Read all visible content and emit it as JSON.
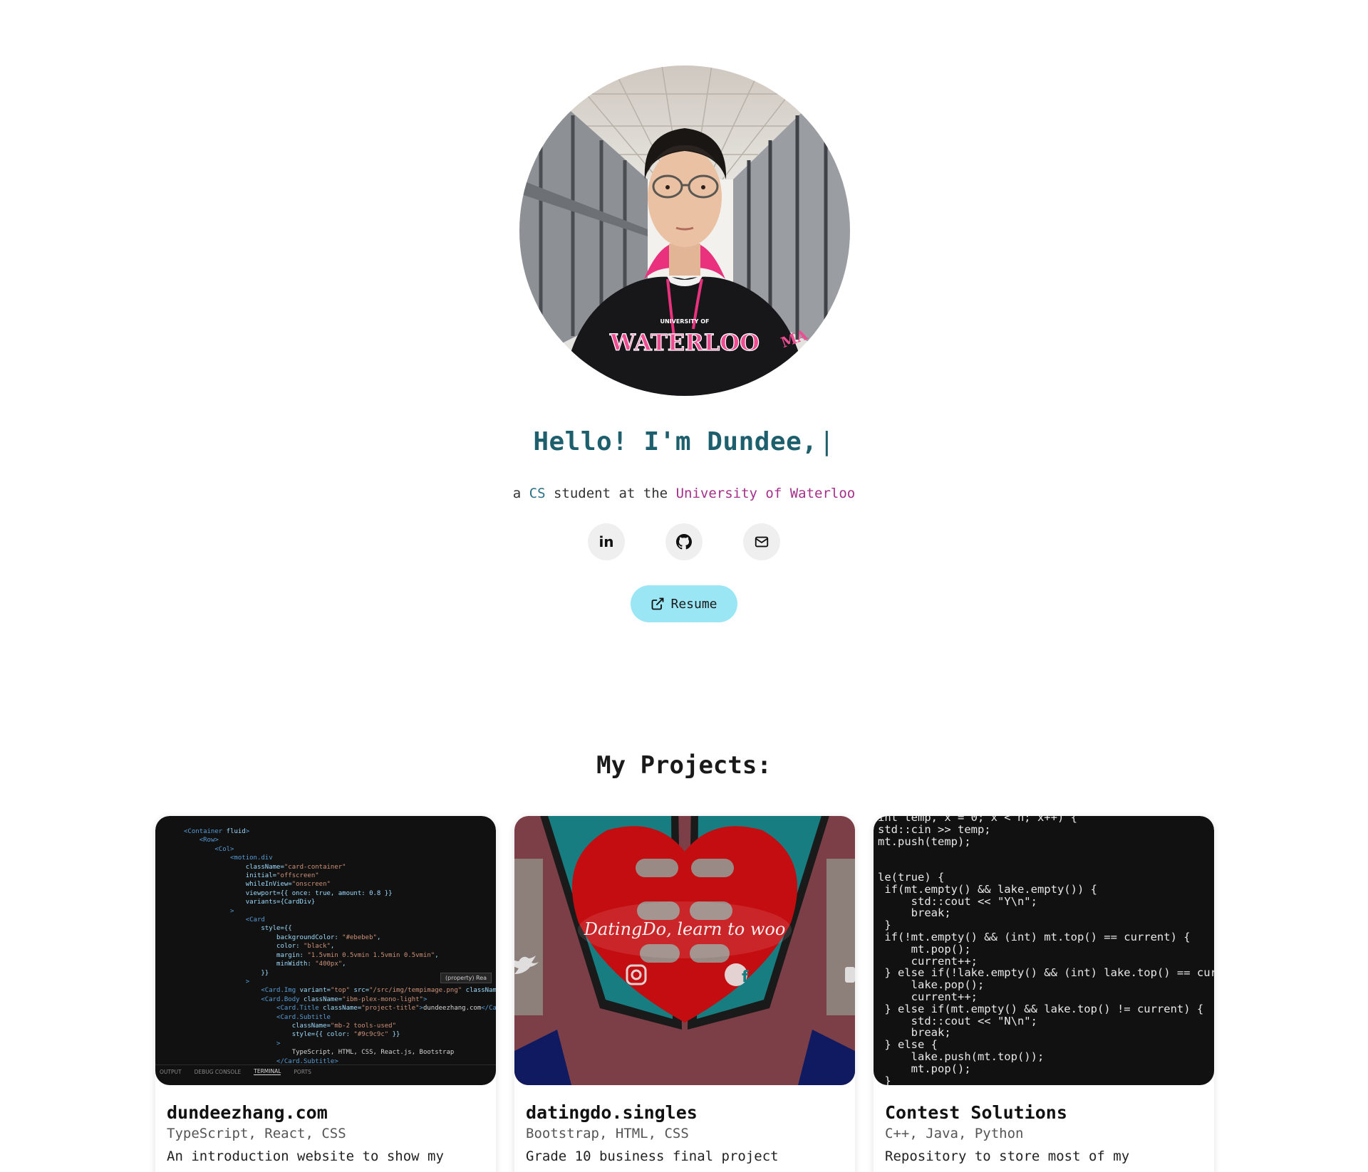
{
  "hero": {
    "greeting": "Hello! I'm Dundee,",
    "cursor": "|",
    "subtitle_prefix": "a ",
    "subtitle_cs": "CS",
    "subtitle_middle": " student at the ",
    "subtitle_uni": "University of Waterloo",
    "hoodie_text_small": "UNIVERSITY OF",
    "hoodie_text_large": "WATERLOO",
    "hoodie_sleeve": "MA"
  },
  "socials": [
    {
      "name": "linkedin",
      "icon": "linkedin-icon",
      "label": "in"
    },
    {
      "name": "github",
      "icon": "github-icon"
    },
    {
      "name": "email",
      "icon": "mail-icon"
    }
  ],
  "resume": {
    "label": "Resume",
    "icon": "external-link-icon"
  },
  "projects": {
    "title": "My Projects:",
    "items": [
      {
        "title": "dundeezhang.com",
        "tools": "TypeScript, React, CSS",
        "description": "An introduction website to show my"
      },
      {
        "title": "datingdo.singles",
        "tools": "Bootstrap, HTML, CSS",
        "description": "Grade 10 business final project",
        "image_caption": "DatingDo, learn to woo"
      },
      {
        "title": "Contest Solutions",
        "tools": "C++, Java, Python",
        "description": "Repository to store most of my"
      }
    ]
  },
  "code_snippet_1": {
    "tabs": [
      "OUTPUT",
      "DEBUG CONSOLE",
      "TERMINAL",
      "PORTS"
    ],
    "tooltip": "(property) Rea"
  },
  "colors": {
    "greeting": "#1e5f6e",
    "cs_highlight": "#2a6f86",
    "uni_highlight": "#a5308a",
    "resume_button": "#9ae6f5",
    "social_button": "#efefef"
  }
}
